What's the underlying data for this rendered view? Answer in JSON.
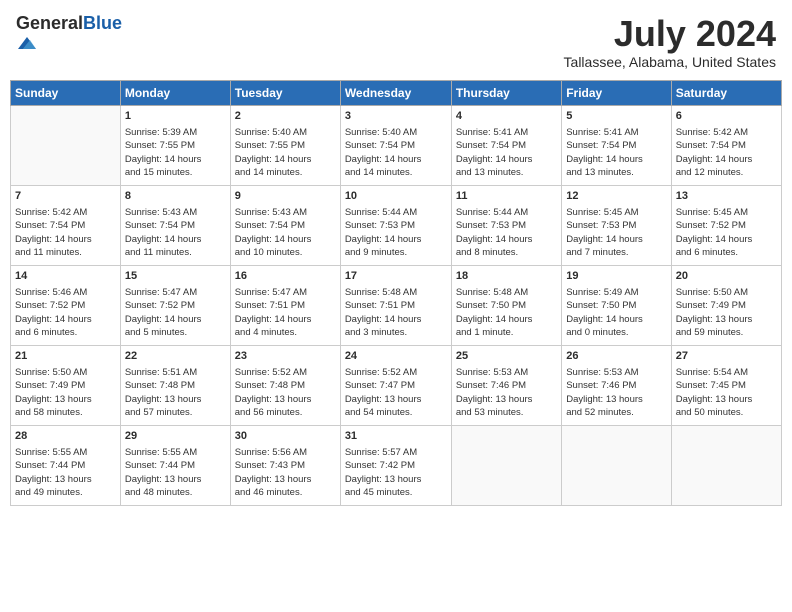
{
  "header": {
    "logo_general": "General",
    "logo_blue": "Blue",
    "month_title": "July 2024",
    "location": "Tallassee, Alabama, United States"
  },
  "days_of_week": [
    "Sunday",
    "Monday",
    "Tuesday",
    "Wednesday",
    "Thursday",
    "Friday",
    "Saturday"
  ],
  "weeks": [
    [
      {
        "day": "",
        "info": ""
      },
      {
        "day": "1",
        "info": "Sunrise: 5:39 AM\nSunset: 7:55 PM\nDaylight: 14 hours\nand 15 minutes."
      },
      {
        "day": "2",
        "info": "Sunrise: 5:40 AM\nSunset: 7:55 PM\nDaylight: 14 hours\nand 14 minutes."
      },
      {
        "day": "3",
        "info": "Sunrise: 5:40 AM\nSunset: 7:54 PM\nDaylight: 14 hours\nand 14 minutes."
      },
      {
        "day": "4",
        "info": "Sunrise: 5:41 AM\nSunset: 7:54 PM\nDaylight: 14 hours\nand 13 minutes."
      },
      {
        "day": "5",
        "info": "Sunrise: 5:41 AM\nSunset: 7:54 PM\nDaylight: 14 hours\nand 13 minutes."
      },
      {
        "day": "6",
        "info": "Sunrise: 5:42 AM\nSunset: 7:54 PM\nDaylight: 14 hours\nand 12 minutes."
      }
    ],
    [
      {
        "day": "7",
        "info": "Sunrise: 5:42 AM\nSunset: 7:54 PM\nDaylight: 14 hours\nand 11 minutes."
      },
      {
        "day": "8",
        "info": "Sunrise: 5:43 AM\nSunset: 7:54 PM\nDaylight: 14 hours\nand 11 minutes."
      },
      {
        "day": "9",
        "info": "Sunrise: 5:43 AM\nSunset: 7:54 PM\nDaylight: 14 hours\nand 10 minutes."
      },
      {
        "day": "10",
        "info": "Sunrise: 5:44 AM\nSunset: 7:53 PM\nDaylight: 14 hours\nand 9 minutes."
      },
      {
        "day": "11",
        "info": "Sunrise: 5:44 AM\nSunset: 7:53 PM\nDaylight: 14 hours\nand 8 minutes."
      },
      {
        "day": "12",
        "info": "Sunrise: 5:45 AM\nSunset: 7:53 PM\nDaylight: 14 hours\nand 7 minutes."
      },
      {
        "day": "13",
        "info": "Sunrise: 5:45 AM\nSunset: 7:52 PM\nDaylight: 14 hours\nand 6 minutes."
      }
    ],
    [
      {
        "day": "14",
        "info": "Sunrise: 5:46 AM\nSunset: 7:52 PM\nDaylight: 14 hours\nand 6 minutes."
      },
      {
        "day": "15",
        "info": "Sunrise: 5:47 AM\nSunset: 7:52 PM\nDaylight: 14 hours\nand 5 minutes."
      },
      {
        "day": "16",
        "info": "Sunrise: 5:47 AM\nSunset: 7:51 PM\nDaylight: 14 hours\nand 4 minutes."
      },
      {
        "day": "17",
        "info": "Sunrise: 5:48 AM\nSunset: 7:51 PM\nDaylight: 14 hours\nand 3 minutes."
      },
      {
        "day": "18",
        "info": "Sunrise: 5:48 AM\nSunset: 7:50 PM\nDaylight: 14 hours\nand 1 minute."
      },
      {
        "day": "19",
        "info": "Sunrise: 5:49 AM\nSunset: 7:50 PM\nDaylight: 14 hours\nand 0 minutes."
      },
      {
        "day": "20",
        "info": "Sunrise: 5:50 AM\nSunset: 7:49 PM\nDaylight: 13 hours\nand 59 minutes."
      }
    ],
    [
      {
        "day": "21",
        "info": "Sunrise: 5:50 AM\nSunset: 7:49 PM\nDaylight: 13 hours\nand 58 minutes."
      },
      {
        "day": "22",
        "info": "Sunrise: 5:51 AM\nSunset: 7:48 PM\nDaylight: 13 hours\nand 57 minutes."
      },
      {
        "day": "23",
        "info": "Sunrise: 5:52 AM\nSunset: 7:48 PM\nDaylight: 13 hours\nand 56 minutes."
      },
      {
        "day": "24",
        "info": "Sunrise: 5:52 AM\nSunset: 7:47 PM\nDaylight: 13 hours\nand 54 minutes."
      },
      {
        "day": "25",
        "info": "Sunrise: 5:53 AM\nSunset: 7:46 PM\nDaylight: 13 hours\nand 53 minutes."
      },
      {
        "day": "26",
        "info": "Sunrise: 5:53 AM\nSunset: 7:46 PM\nDaylight: 13 hours\nand 52 minutes."
      },
      {
        "day": "27",
        "info": "Sunrise: 5:54 AM\nSunset: 7:45 PM\nDaylight: 13 hours\nand 50 minutes."
      }
    ],
    [
      {
        "day": "28",
        "info": "Sunrise: 5:55 AM\nSunset: 7:44 PM\nDaylight: 13 hours\nand 49 minutes."
      },
      {
        "day": "29",
        "info": "Sunrise: 5:55 AM\nSunset: 7:44 PM\nDaylight: 13 hours\nand 48 minutes."
      },
      {
        "day": "30",
        "info": "Sunrise: 5:56 AM\nSunset: 7:43 PM\nDaylight: 13 hours\nand 46 minutes."
      },
      {
        "day": "31",
        "info": "Sunrise: 5:57 AM\nSunset: 7:42 PM\nDaylight: 13 hours\nand 45 minutes."
      },
      {
        "day": "",
        "info": ""
      },
      {
        "day": "",
        "info": ""
      },
      {
        "day": "",
        "info": ""
      }
    ]
  ]
}
